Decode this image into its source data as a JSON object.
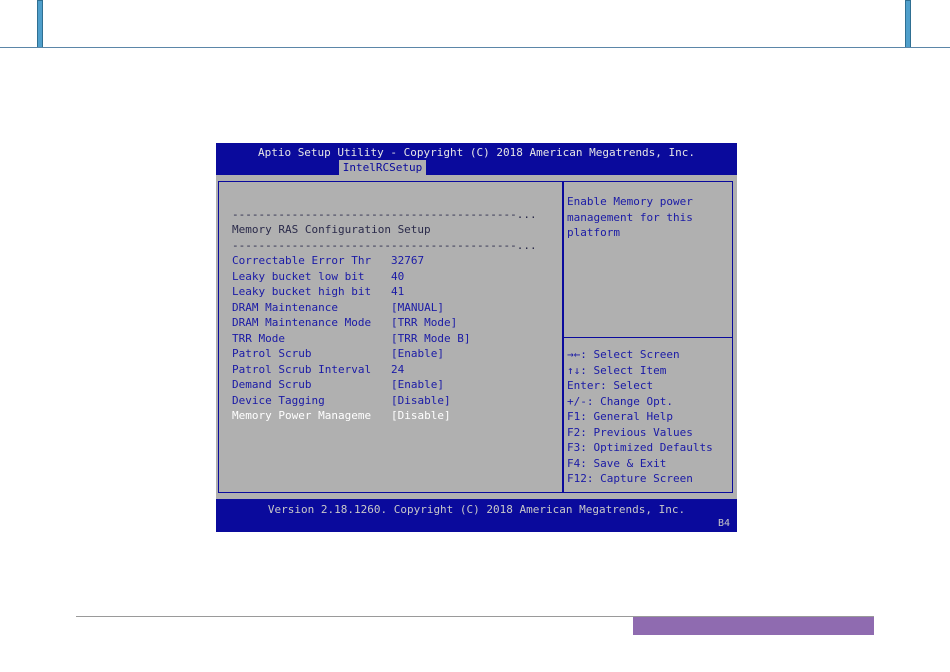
{
  "bios": {
    "title": "Aptio Setup Utility - Copyright (C) 2018 American Megatrends, Inc.",
    "active_tab": "IntelRCSetup",
    "dashes1": "-------------------------------------------...",
    "section_heading": "Memory RAS Configuration Setup",
    "dashes2": "-------------------------------------------...",
    "settings": [
      {
        "label": "Correctable Error Thr",
        "value": "32767"
      },
      {
        "label": "Leaky bucket low bit",
        "value": "40"
      },
      {
        "label": "Leaky bucket high bit",
        "value": "41"
      },
      {
        "label": "DRAM Maintenance",
        "value": "[MANUAL]"
      },
      {
        "label": "DRAM Maintenance Mode",
        "value": "[TRR Mode]"
      },
      {
        "label": "TRR Mode",
        "value": "[TRR Mode B]"
      },
      {
        "label": "Patrol Scrub",
        "value": "[Enable]"
      },
      {
        "label": "Patrol Scrub Interval",
        "value": "24"
      },
      {
        "label": "Demand Scrub",
        "value": "[Enable]"
      },
      {
        "label": "Device Tagging",
        "value": "[Disable]"
      },
      {
        "label": "Memory Power Manageme",
        "value": "[Disable]"
      }
    ],
    "selected_index": 10,
    "help_text": "Enable Memory power\nmanagement for this\nplatform",
    "key_help": [
      "→←: Select Screen",
      "↑↓: Select Item",
      "Enter: Select",
      "+/-: Change Opt.",
      "F1: General Help",
      "F2: Previous Values",
      "F3: Optimized Defaults",
      "F4: Save & Exit",
      "F12: Capture Screen"
    ],
    "version": "Version 2.18.1260. Copyright (C) 2018 American Megatrends, Inc.",
    "code": "B4"
  },
  "colors": {
    "bios_blue": "#0a0a9c",
    "bios_gray": "#b0b0b0",
    "footer_accent": "#8f6bb0",
    "header_accent": "#4f9fcb"
  }
}
